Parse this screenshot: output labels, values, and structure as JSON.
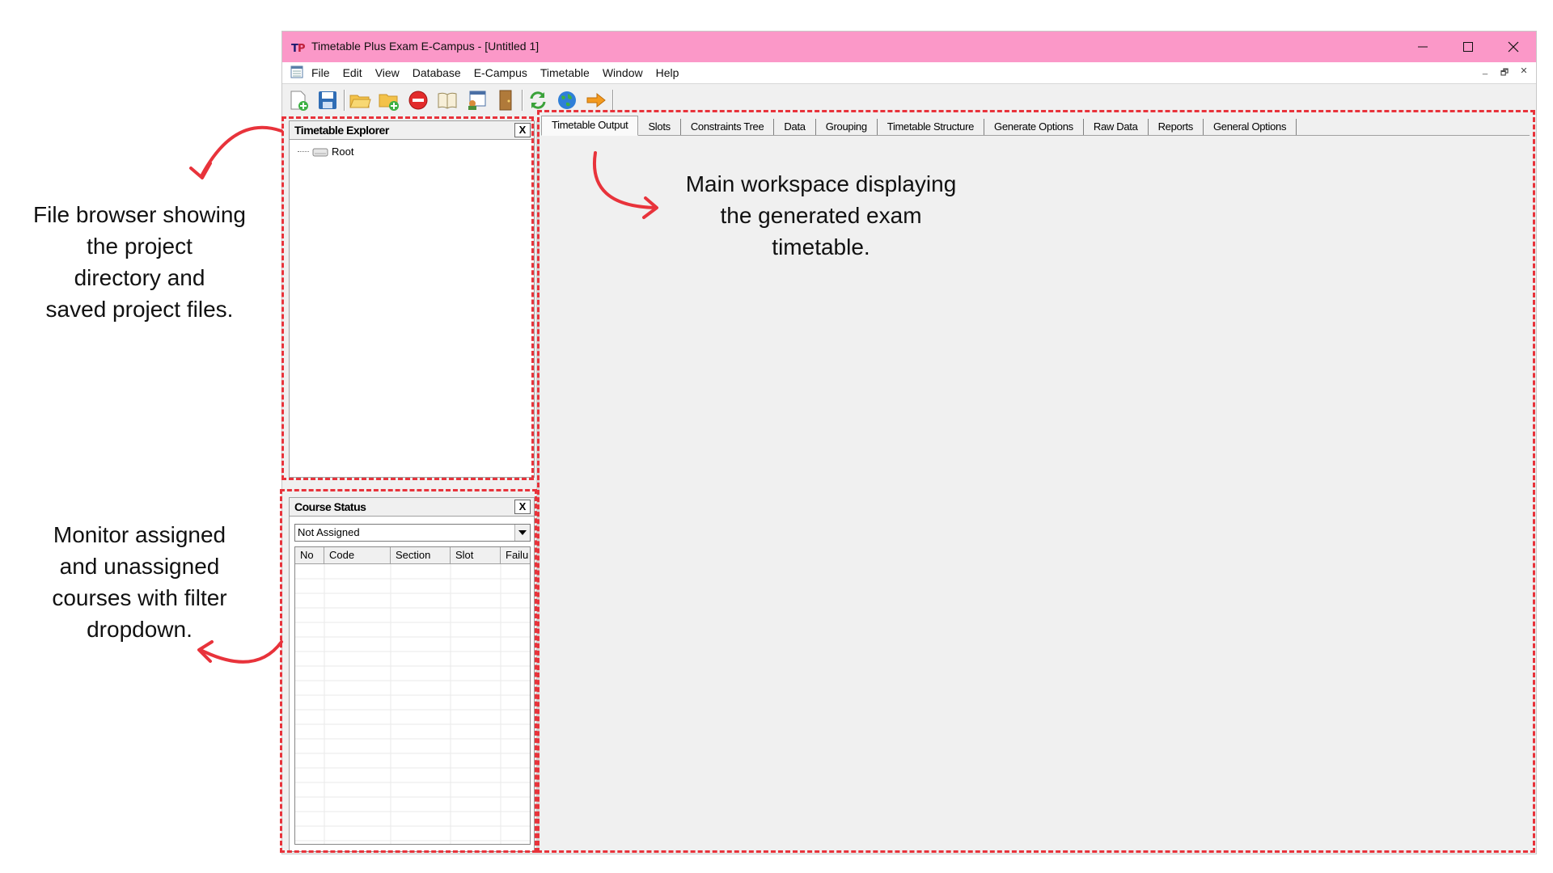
{
  "window": {
    "title": "Timetable Plus Exam E-Campus - [Untitled 1]",
    "titlebar_color": "#fb98c8"
  },
  "menubar": {
    "items": [
      "File",
      "Edit",
      "View",
      "Database",
      "E-Campus",
      "Timetable",
      "Window",
      "Help"
    ]
  },
  "toolbar": {
    "icons": [
      "new-icon",
      "save-icon",
      "open-folder-icon",
      "add-folder-icon",
      "stop-icon",
      "book-icon",
      "calendar-user-icon",
      "door-icon",
      "refresh-icon",
      "globe-icon",
      "forward-arrow-icon"
    ]
  },
  "explorer": {
    "title": "Timetable Explorer",
    "close": "X",
    "root_label": "Root"
  },
  "course_status": {
    "title": "Course Status",
    "close": "X",
    "filter_value": "Not Assigned",
    "columns": [
      "No",
      "Code",
      "Section",
      "Slot",
      "Failu"
    ]
  },
  "tabs": [
    {
      "label": "Timetable Output",
      "active": true
    },
    {
      "label": "Slots"
    },
    {
      "label": "Constraints Tree"
    },
    {
      "label": "Data"
    },
    {
      "label": "Grouping"
    },
    {
      "label": "Timetable Structure"
    },
    {
      "label": "Generate Options"
    },
    {
      "label": "Raw Data"
    },
    {
      "label": "Reports"
    },
    {
      "label": "General Options"
    }
  ],
  "annotations": {
    "explorer": [
      "File browser showing",
      "the project",
      "directory and",
      "saved project files."
    ],
    "course_status": [
      "Monitor assigned",
      "and unassigned",
      "courses with filter",
      "dropdown."
    ],
    "workspace": [
      "Main workspace displaying",
      "the generated exam",
      "timetable."
    ],
    "color": "#e8333b"
  }
}
